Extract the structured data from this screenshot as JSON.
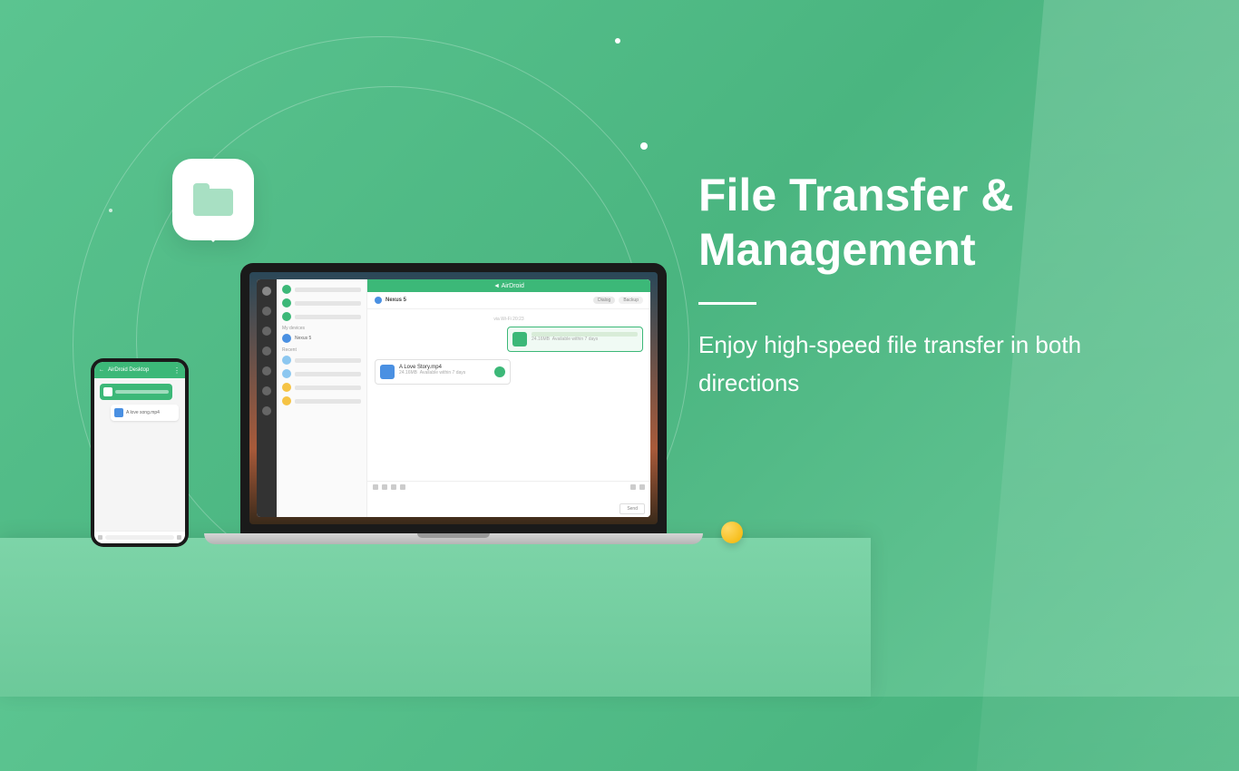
{
  "headline": {
    "title_line1": "File Transfer &",
    "title_line2": "Management",
    "subtitle": "Enjoy high-speed file transfer in both directions"
  },
  "laptop_app": {
    "brand": "AirDroid",
    "contact_name": "Nexus 5",
    "tabs": {
      "dialog": "Dialog",
      "backup": "Backup"
    },
    "date_label": "via Wi-Fi 20:23",
    "list_sections": {
      "my_devices": "My devices",
      "recent": "Recent"
    },
    "list_device": "Nexus 5",
    "file_sent": {
      "size": "24.16MB",
      "availability": "Available within 7 days"
    },
    "file_received": {
      "name": "A Love Story.mp4",
      "size": "24.16MB",
      "availability": "Available within 7 days"
    },
    "send_button": "Send"
  },
  "phone_app": {
    "title": "AirDroid Desktop",
    "file_name": "A love song.mp4"
  }
}
